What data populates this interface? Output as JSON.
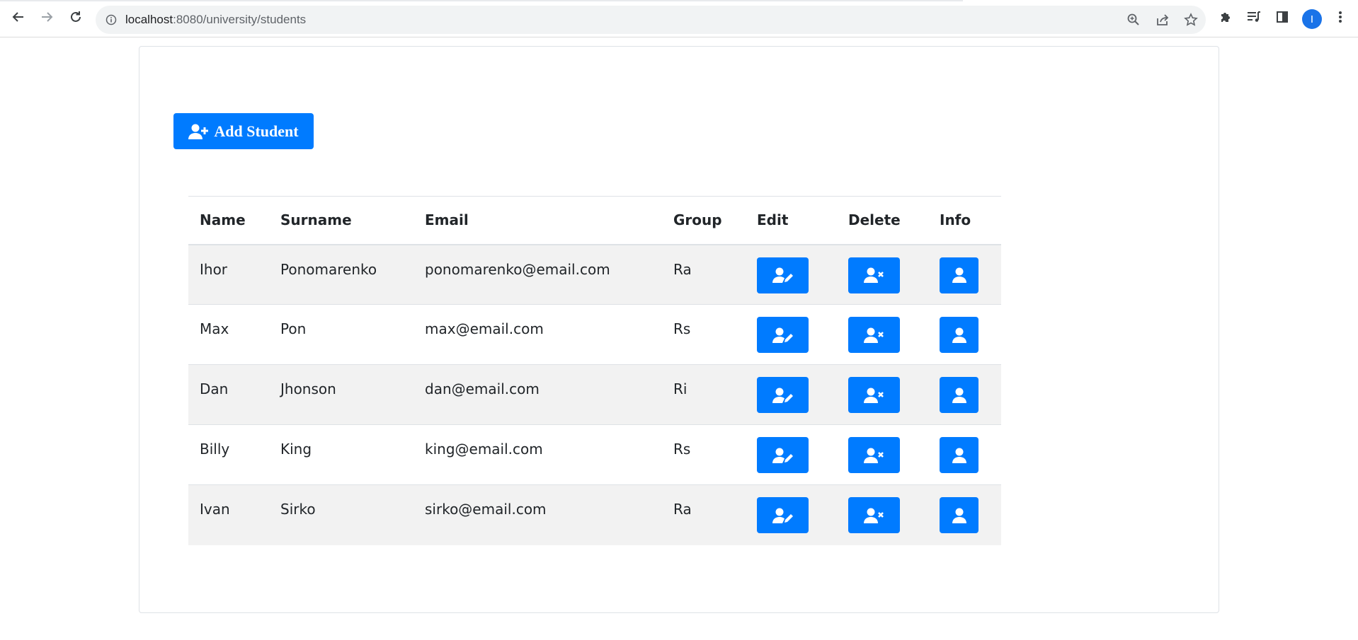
{
  "browser": {
    "url_host": "localhost",
    "url_path": ":8080/university/students",
    "profile_initial": "I"
  },
  "page": {
    "add_button_label": "Add Student"
  },
  "table": {
    "headers": {
      "name": "Name",
      "surname": "Surname",
      "email": "Email",
      "group": "Group",
      "edit": "Edit",
      "delete": "Delete",
      "info": "Info"
    },
    "rows": [
      {
        "name": "Ihor",
        "surname": "Ponomarenko",
        "email": "ponomarenko@email.com",
        "group": "Ra"
      },
      {
        "name": "Max",
        "surname": "Pon",
        "email": "max@email.com",
        "group": "Rs"
      },
      {
        "name": "Dan",
        "surname": "Jhonson",
        "email": "dan@email.com",
        "group": "Ri"
      },
      {
        "name": "Billy",
        "surname": "King",
        "email": "king@email.com",
        "group": "Rs"
      },
      {
        "name": "Ivan",
        "surname": "Sirko",
        "email": "sirko@email.com",
        "group": "Ra"
      }
    ]
  },
  "icons": {
    "back": "arrow-left-icon",
    "forward": "arrow-right-icon",
    "reload": "reload-icon",
    "info": "info-circle-icon",
    "zoom": "zoom-icon",
    "share": "share-icon",
    "star": "star-icon",
    "extensions": "puzzle-icon",
    "media": "media-queue-icon",
    "sidepanel": "side-panel-icon",
    "add_user": "user-plus-icon",
    "edit_user": "user-edit-icon",
    "delete_user": "user-times-icon",
    "info_user": "user-icon"
  },
  "colors": {
    "primary": "#007bff",
    "striped_row": "#f2f2f2",
    "profile": "#1a73e8"
  }
}
